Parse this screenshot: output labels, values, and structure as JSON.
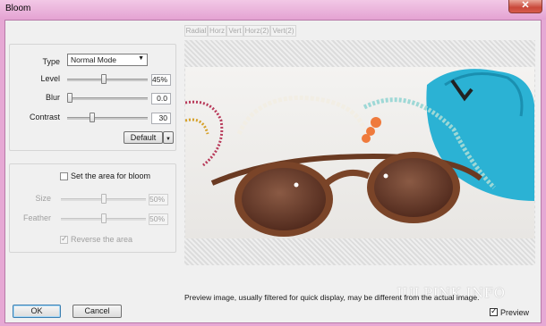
{
  "window": {
    "title": "Bloom",
    "close_glyph": "✕"
  },
  "settings": {
    "type_label": "Type",
    "type_value": "Normal Mode",
    "level_label": "Level",
    "level_value": "45%",
    "blur_label": "Blur",
    "blur_value": "0.0",
    "contrast_label": "Contrast",
    "contrast_value": "30",
    "default_button": "Default",
    "slider_levels": {
      "level": 0.45,
      "blur": 0.0,
      "contrast": 0.3
    }
  },
  "area": {
    "checkbox_label": "Set the area for bloom",
    "size_label": "Size",
    "size_value": "50%",
    "feather_label": "Feather",
    "feather_value": "50%",
    "reverse_label": "Reverse the area",
    "slider_levels": {
      "size": 0.5,
      "feather": 0.5
    }
  },
  "tabs": [
    "Radial",
    "Horz",
    "Vert",
    "Horz(2)",
    "Vert(2)"
  ],
  "preview": {
    "note": "Preview image, usually filtered for quick display, may be different from the actual image.",
    "checkbox_label": "Preview",
    "checked": true
  },
  "watermark": "JULPINK.INFO",
  "footer": {
    "ok_label": "OK",
    "cancel_label": "Cancel"
  },
  "colors": {
    "title_bar": "#e4a2d2",
    "close_button": "#c9483a",
    "tab_accent": "#3aa8c8"
  }
}
